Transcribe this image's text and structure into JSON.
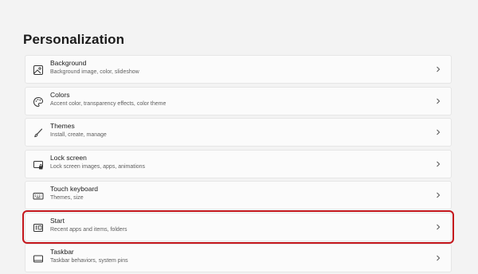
{
  "page": {
    "title": "Personalization"
  },
  "items": [
    {
      "label": "Background",
      "description": "Background image, color, slideshow",
      "icon": "image-icon"
    },
    {
      "label": "Colors",
      "description": "Accent color, transparency effects, color theme",
      "icon": "palette-icon"
    },
    {
      "label": "Themes",
      "description": "Install, create, manage",
      "icon": "brush-icon"
    },
    {
      "label": "Lock screen",
      "description": "Lock screen images, apps, animations",
      "icon": "lock-screen-icon"
    },
    {
      "label": "Touch keyboard",
      "description": "Themes, size",
      "icon": "keyboard-icon"
    },
    {
      "label": "Start",
      "description": "Recent apps and items, folders",
      "icon": "start-icon"
    },
    {
      "label": "Taskbar",
      "description": "Taskbar behaviors, system pins",
      "icon": "taskbar-icon"
    }
  ],
  "highlight": {
    "color": "#c4161c",
    "item_label": "Start"
  }
}
